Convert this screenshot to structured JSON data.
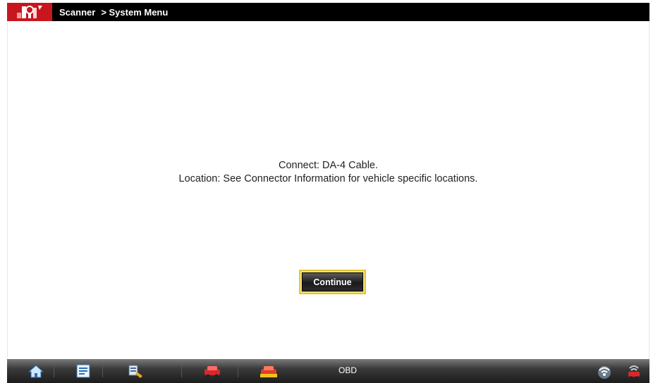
{
  "titlebar": {
    "logo_icon": "scanner-logo-icon",
    "crumbs": [
      "Scanner",
      "> System Menu"
    ]
  },
  "message": {
    "line1": "Connect: DA-4 Cable.",
    "line2": "Location: See Connector Information for vehicle specific locations."
  },
  "buttons": {
    "continue_label": "Continue"
  },
  "taskbar": {
    "label": "OBD",
    "icons": [
      "home-icon",
      "data-list-icon",
      "tools-icon",
      "vehicle-red-icon",
      "vehicle-yellow-icon",
      "wireless-icon",
      "wireless-vehicle-icon"
    ]
  },
  "colors": {
    "titlebar_bg": "#000000",
    "logo_bg": "#c8161e",
    "button_highlight": "#e2c72a"
  }
}
